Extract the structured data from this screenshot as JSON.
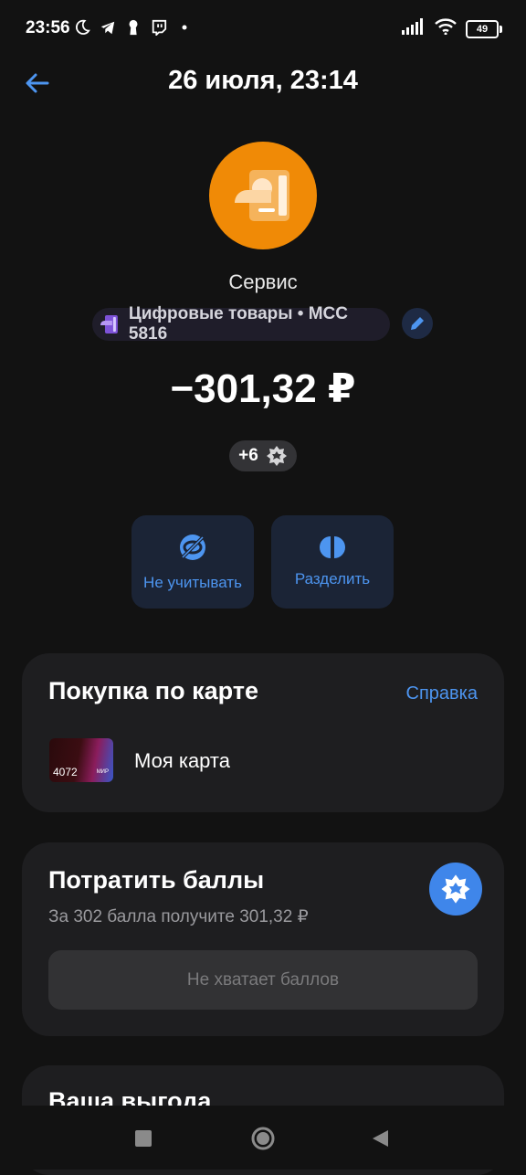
{
  "status_bar": {
    "time": "23:56",
    "battery": "49",
    "icons_left": [
      "moon-icon",
      "telegram-icon",
      "keyhole-icon",
      "twitch-icon",
      "dot-icon"
    ],
    "icons_right": [
      "signal-icon",
      "wifi-icon",
      "battery-icon"
    ]
  },
  "header": {
    "title": "26 июля, 23:14",
    "back_icon": "arrow-left-icon"
  },
  "transaction": {
    "merchant": "Сервис",
    "category": "Цифровые товары • MCC 5816",
    "amount": "−301,32 ₽",
    "bonus": "+6"
  },
  "actions": [
    {
      "label": "Не учитывать",
      "icon": "eye-off-icon"
    },
    {
      "label": "Разделить",
      "icon": "split-icon"
    }
  ],
  "purchase_card": {
    "title": "Покупка по карте",
    "help_link": "Справка",
    "card_name": "Моя карта",
    "card_number": "4072",
    "card_brand": "МИР"
  },
  "spend_points": {
    "title": "Потратить баллы",
    "subtitle": "За 302 балла получите 301,32 ₽",
    "button": "Не хватает баллов"
  },
  "benefit": {
    "title": "Ваша выгода"
  },
  "colors": {
    "background": "#121212",
    "accent": "#4d95f0",
    "avatar": "#f08a06",
    "card": "#1e1e20"
  }
}
